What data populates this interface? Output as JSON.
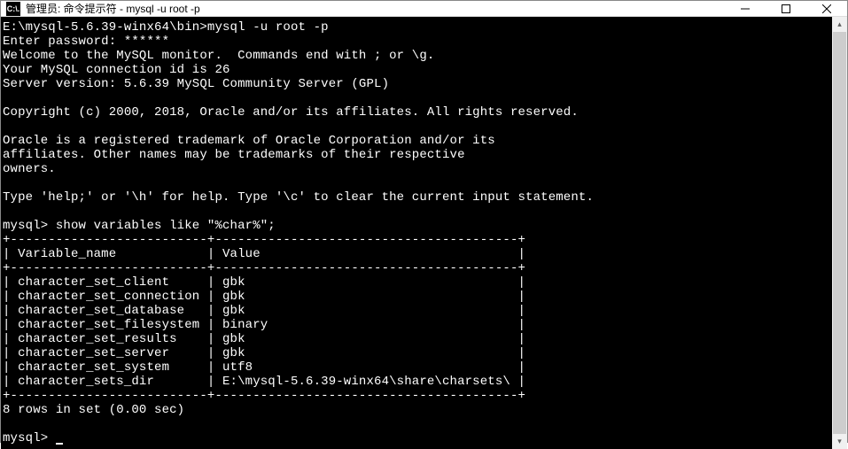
{
  "window": {
    "title": "管理员: 命令提示符 - mysql  -u root -p",
    "icon_text": "C:\\."
  },
  "terminal": {
    "lines": [
      "E:\\mysql-5.6.39-winx64\\bin>mysql -u root -p",
      "Enter password: ******",
      "Welcome to the MySQL monitor.  Commands end with ; or \\g.",
      "Your MySQL connection id is 26",
      "Server version: 5.6.39 MySQL Community Server (GPL)",
      "",
      "Copyright (c) 2000, 2018, Oracle and/or its affiliates. All rights reserved.",
      "",
      "Oracle is a registered trademark of Oracle Corporation and/or its",
      "affiliates. Other names may be trademarks of their respective",
      "owners.",
      "",
      "Type 'help;' or '\\h' for help. Type '\\c' to clear the current input statement.",
      "",
      "mysql> show variables like \"%char%\";",
      "+--------------------------+----------------------------------------+",
      "| Variable_name            | Value                                  |",
      "+--------------------------+----------------------------------------+",
      "| character_set_client     | gbk                                    |",
      "| character_set_connection | gbk                                    |",
      "| character_set_database   | gbk                                    |",
      "| character_set_filesystem | binary                                 |",
      "| character_set_results    | gbk                                    |",
      "| character_set_server     | gbk                                    |",
      "| character_set_system     | utf8                                   |",
      "| character_sets_dir       | E:\\mysql-5.6.39-winx64\\share\\charsets\\ |",
      "+--------------------------+----------------------------------------+",
      "8 rows in set (0.00 sec)",
      "",
      "mysql> "
    ]
  },
  "chart_data": {
    "type": "table",
    "title": "show variables like \"%char%\"",
    "columns": [
      "Variable_name",
      "Value"
    ],
    "rows": [
      [
        "character_set_client",
        "gbk"
      ],
      [
        "character_set_connection",
        "gbk"
      ],
      [
        "character_set_database",
        "gbk"
      ],
      [
        "character_set_filesystem",
        "binary"
      ],
      [
        "character_set_results",
        "gbk"
      ],
      [
        "character_set_server",
        "gbk"
      ],
      [
        "character_set_system",
        "utf8"
      ],
      [
        "character_sets_dir",
        "E:\\mysql-5.6.39-winx64\\share\\charsets\\"
      ]
    ],
    "footer": "8 rows in set (0.00 sec)"
  }
}
